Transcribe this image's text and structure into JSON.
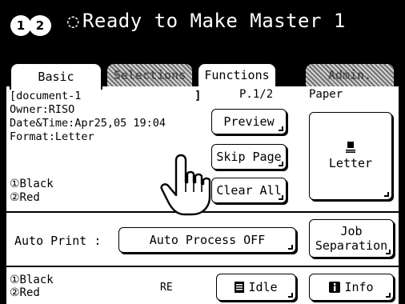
{
  "header": {
    "drum_icons": [
      "1",
      "2"
    ],
    "status_glyph": "◌",
    "title": "Ready to Make Master 1"
  },
  "tabs": [
    {
      "label": "Basic",
      "state": "active"
    },
    {
      "label": "Selections",
      "state": "disabled"
    },
    {
      "label": "Functions",
      "state": "normal"
    },
    {
      "label": "Admin.",
      "state": "disabled"
    }
  ],
  "document": {
    "name_open": "[document-1",
    "name_close": "]",
    "owner": "Owner:RISO",
    "datetime": "Date&Time:Apr25,05 19:04",
    "format": "Format:Letter",
    "color1": "①Black",
    "color2": "②Red"
  },
  "page_indicator": "P.1/2",
  "buttons": {
    "preview": "Preview",
    "skip_page": "Skip Page",
    "clear_all": "Clear All",
    "auto_process": "Auto Process OFF",
    "job_separation_1": "Job",
    "job_separation_2": "Separation",
    "idle": "Idle",
    "info": "Info"
  },
  "paper": {
    "label": "Paper",
    "size": "Letter",
    "icon": "paper-stack-icon"
  },
  "auto_print_label": "Auto Print :",
  "status_bar": {
    "color1": "①Black",
    "color2": "②Red",
    "partial_text": "RE"
  },
  "colors": {
    "background": "#000000",
    "panel": "#ffffff",
    "accent": "#000000"
  }
}
